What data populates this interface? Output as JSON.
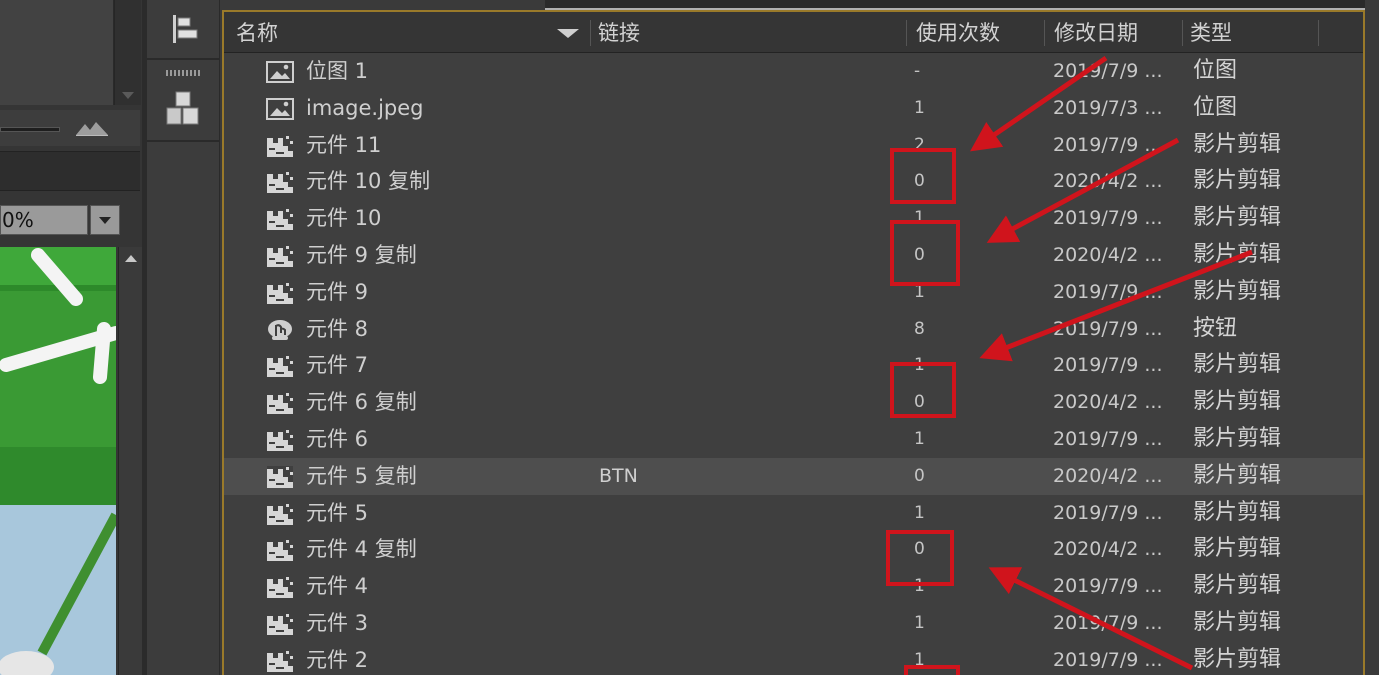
{
  "stage": {
    "zoom_value": "0%"
  },
  "library": {
    "columns": {
      "name": "名称",
      "link": "链接",
      "use_count": "使用次数",
      "modified": "修改日期",
      "type": "类型"
    },
    "items": [
      {
        "icon": "bitmap-icon",
        "name": "位图 1",
        "link": "",
        "use_count": "-",
        "modified": "2019/7/9 ...",
        "type": "位图"
      },
      {
        "icon": "bitmap-icon",
        "name": "image.jpeg",
        "link": "",
        "use_count": "1",
        "modified": "2019/7/3 ...",
        "type": "位图"
      },
      {
        "icon": "movieclip-icon",
        "name": "元件 11",
        "link": "",
        "use_count": "2",
        "modified": "2019/7/9 ...",
        "type": "影片剪辑"
      },
      {
        "icon": "movieclip-icon",
        "name": "元件 10 复制",
        "link": "",
        "use_count": "0",
        "modified": "2020/4/2 ...",
        "type": "影片剪辑"
      },
      {
        "icon": "movieclip-icon",
        "name": "元件 10",
        "link": "",
        "use_count": "1",
        "modified": "2019/7/9 ...",
        "type": "影片剪辑"
      },
      {
        "icon": "movieclip-icon",
        "name": "元件 9 复制",
        "link": "",
        "use_count": "0",
        "modified": "2020/4/2 ...",
        "type": "影片剪辑"
      },
      {
        "icon": "movieclip-icon",
        "name": "元件 9",
        "link": "",
        "use_count": "1",
        "modified": "2019/7/9 ...",
        "type": "影片剪辑"
      },
      {
        "icon": "button-symbol-icon",
        "name": "元件 8",
        "link": "",
        "use_count": "8",
        "modified": "2019/7/9 ...",
        "type": "按钮"
      },
      {
        "icon": "movieclip-icon",
        "name": "元件 7",
        "link": "",
        "use_count": "1",
        "modified": "2019/7/9 ...",
        "type": "影片剪辑"
      },
      {
        "icon": "movieclip-icon",
        "name": "元件 6 复制",
        "link": "",
        "use_count": "0",
        "modified": "2020/4/2 ...",
        "type": "影片剪辑"
      },
      {
        "icon": "movieclip-icon",
        "name": "元件 6",
        "link": "",
        "use_count": "1",
        "modified": "2019/7/9 ...",
        "type": "影片剪辑"
      },
      {
        "icon": "movieclip-icon",
        "name": "元件 5 复制",
        "link": "BTN",
        "use_count": "0",
        "modified": "2020/4/2 ...",
        "type": "影片剪辑",
        "selected": true
      },
      {
        "icon": "movieclip-icon",
        "name": "元件 5",
        "link": "",
        "use_count": "1",
        "modified": "2019/7/9 ...",
        "type": "影片剪辑"
      },
      {
        "icon": "movieclip-icon",
        "name": "元件 4 复制",
        "link": "",
        "use_count": "0",
        "modified": "2020/4/2 ...",
        "type": "影片剪辑"
      },
      {
        "icon": "movieclip-icon",
        "name": "元件 4",
        "link": "",
        "use_count": "1",
        "modified": "2019/7/9 ...",
        "type": "影片剪辑"
      },
      {
        "icon": "movieclip-icon",
        "name": "元件 3",
        "link": "",
        "use_count": "1",
        "modified": "2019/7/9 ...",
        "type": "影片剪辑"
      },
      {
        "icon": "movieclip-icon",
        "name": "元件 2",
        "link": "",
        "use_count": "1",
        "modified": "2019/7/9 ...",
        "type": "影片剪辑"
      }
    ]
  },
  "colors": {
    "annotation": "#d0141c",
    "panel_border": "#9a7a2a",
    "selected_row": "#4e4e4e"
  }
}
